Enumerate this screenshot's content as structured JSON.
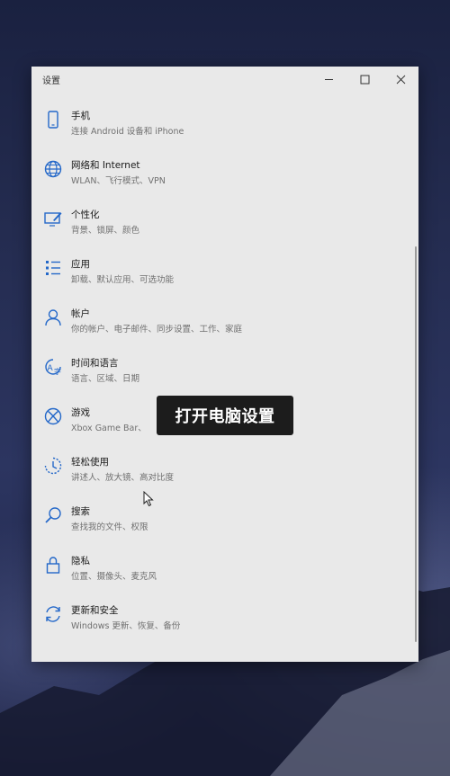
{
  "window": {
    "title": "设置",
    "controls": {
      "minimize": "minimize-icon",
      "maximize": "maximize-icon",
      "close": "close-icon"
    }
  },
  "items": [
    {
      "name": "手机",
      "desc": "连接 Android 设备和 iPhone",
      "icon": "phone-icon"
    },
    {
      "name": "网络和 Internet",
      "desc": "WLAN、飞行模式、VPN",
      "icon": "globe-icon"
    },
    {
      "name": "个性化",
      "desc": "背景、锁屏、颜色",
      "icon": "personalization-icon"
    },
    {
      "name": "应用",
      "desc": "卸载、默认应用、可选功能",
      "icon": "apps-icon"
    },
    {
      "name": "帐户",
      "desc": "你的帐户、电子邮件、同步设置、工作、家庭",
      "icon": "account-icon"
    },
    {
      "name": "时间和语言",
      "desc": "语言、区域、日期",
      "icon": "time-language-icon"
    },
    {
      "name": "游戏",
      "desc": "Xbox Game Bar、",
      "icon": "xbox-icon"
    },
    {
      "name": "轻松使用",
      "desc": "讲述人、放大镜、高对比度",
      "icon": "ease-of-access-icon"
    },
    {
      "name": "搜索",
      "desc": "查找我的文件、权限",
      "icon": "search-icon"
    },
    {
      "name": "隐私",
      "desc": "位置、摄像头、麦克风",
      "icon": "lock-icon"
    },
    {
      "name": "更新和安全",
      "desc": "Windows 更新、恢复、备份",
      "icon": "update-icon"
    }
  ],
  "overlay_caption": "打开电脑设置",
  "colors": {
    "accent": "#2468c9",
    "window_bg": "#e9e9e9",
    "caption_bg": "#1c1c1c"
  }
}
